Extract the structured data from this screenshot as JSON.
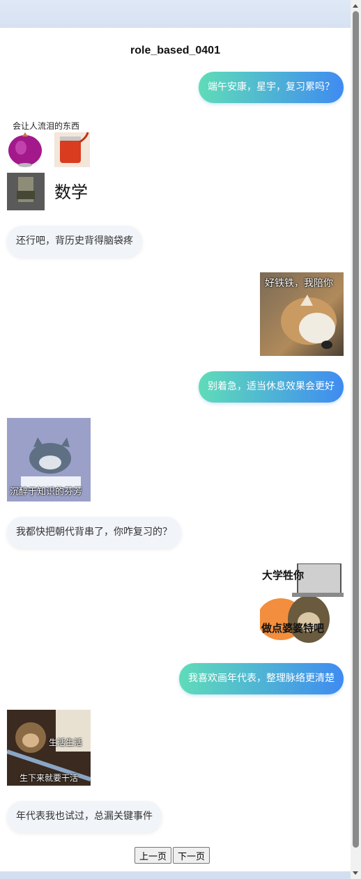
{
  "chat": {
    "title": "role_based_0401"
  },
  "messages": [
    {
      "text": "端午安康，星宇，复习累吗？"
    },
    {
      "meme": {
        "caption": "会让人流泪的东西",
        "math": "数学"
      }
    },
    {
      "text": "还行吧，背历史背得脑袋疼"
    },
    {
      "meme": {
        "caption": "好铁铁，我陪你"
      }
    },
    {
      "text": "别着急，适当休息效果会更好"
    },
    {
      "meme": {
        "caption": "沉醉于知识的芬芳"
      }
    },
    {
      "text": "我都快把朝代背串了，你咋复习的？"
    },
    {
      "meme": {
        "top": "大学牲你",
        "bottom": "做点婆婆特吧"
      }
    },
    {
      "text": "我喜欢画年代表，整理脉络更清楚"
    },
    {
      "meme": {
        "top": "生活生活",
        "bottom": "生下来就要干活"
      }
    },
    {
      "text": "年代表我也试过，总漏关键事件"
    }
  ],
  "pager": {
    "prev": "上一页",
    "next": "下一页"
  },
  "colors": {
    "sent_start": "#5fdcb8",
    "sent_end": "#3f8bf1",
    "received_bg": "#f1f4f8"
  }
}
